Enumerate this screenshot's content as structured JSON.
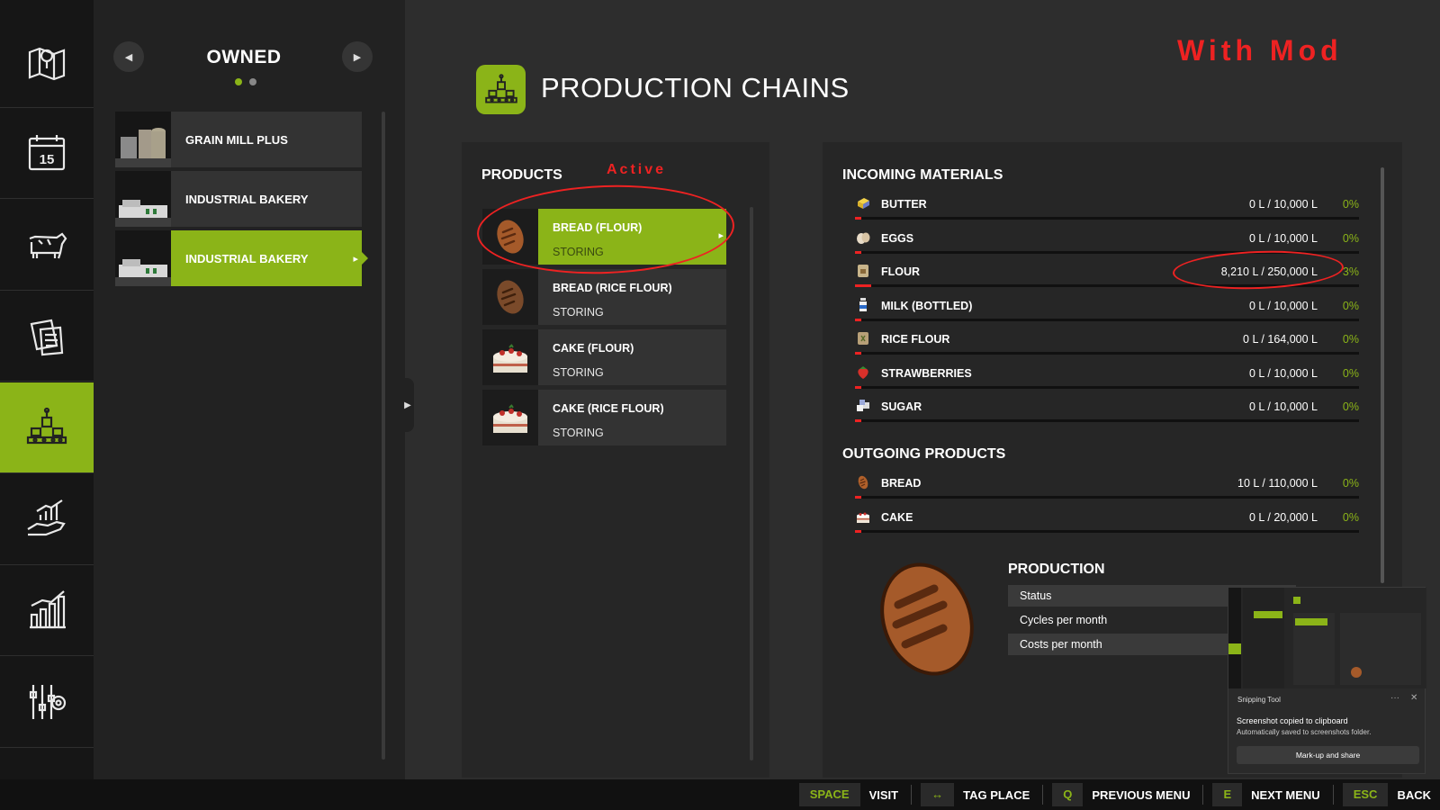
{
  "rail": {
    "items": [
      {
        "name": "map",
        "icon": "map-pin-icon"
      },
      {
        "name": "calendar",
        "icon": "calendar-icon",
        "label": "15"
      },
      {
        "name": "animals",
        "icon": "cow-icon"
      },
      {
        "name": "contracts",
        "icon": "documents-icon"
      },
      {
        "name": "production",
        "icon": "production-factory-icon",
        "active": true
      },
      {
        "name": "finances",
        "icon": "hand-chart-icon"
      },
      {
        "name": "statistics",
        "icon": "bar-chart-icon"
      },
      {
        "name": "settings",
        "icon": "gear-sliders-icon"
      }
    ]
  },
  "owned": {
    "title": "OWNED",
    "items": [
      {
        "label": "GRAIN MILL PLUS"
      },
      {
        "label": "INDUSTRIAL BAKERY"
      },
      {
        "label": "INDUSTRIAL BAKERY",
        "active": true
      }
    ]
  },
  "main": {
    "title": "PRODUCTION CHAINS",
    "annotation": "With Mod"
  },
  "products": {
    "title": "PRODUCTS",
    "annotation": "Active",
    "items": [
      {
        "name": "BREAD (FLOUR)",
        "status": "STORING",
        "icon": "bread-icon",
        "active": true
      },
      {
        "name": "BREAD (RICE FLOUR)",
        "status": "STORING",
        "icon": "bread-icon"
      },
      {
        "name": "CAKE (FLOUR)",
        "status": "STORING",
        "icon": "cake-icon"
      },
      {
        "name": "CAKE (RICE FLOUR)",
        "status": "STORING",
        "icon": "cake-icon"
      }
    ]
  },
  "incoming": {
    "title": "INCOMING MATERIALS",
    "items": [
      {
        "name": "BUTTER",
        "value": "0 L / 10,000 L",
        "percent": "0%",
        "fill": 0.0,
        "icon": "butter-icon"
      },
      {
        "name": "EGGS",
        "value": "0 L / 10,000 L",
        "percent": "0%",
        "fill": 0.0,
        "icon": "eggs-icon"
      },
      {
        "name": "FLOUR",
        "value": "8,210 L / 250,000 L",
        "percent": "3%",
        "fill": 0.033,
        "icon": "flour-icon"
      },
      {
        "name": "MILK (BOTTLED)",
        "value": "0 L / 10,000 L",
        "percent": "0%",
        "fill": 0.0,
        "icon": "milk-bottle-icon"
      },
      {
        "name": "RICE FLOUR",
        "value": "0 L / 164,000 L",
        "percent": "0%",
        "fill": 0.0,
        "icon": "rice-flour-icon"
      },
      {
        "name": "STRAWBERRIES",
        "value": "0 L / 10,000 L",
        "percent": "0%",
        "fill": 0.0,
        "icon": "strawberry-icon"
      },
      {
        "name": "SUGAR",
        "value": "0 L / 10,000 L",
        "percent": "0%",
        "fill": 0.0,
        "icon": "sugar-icon"
      }
    ]
  },
  "outgoing": {
    "title": "OUTGOING PRODUCTS",
    "items": [
      {
        "name": "BREAD",
        "value": "10 L / 110,000 L",
        "percent": "0%",
        "fill": 0.0,
        "icon": "bread-icon"
      },
      {
        "name": "CAKE",
        "value": "0 L / 20,000 L",
        "percent": "0%",
        "fill": 0.0,
        "icon": "cake-icon"
      }
    ]
  },
  "production": {
    "title": "PRODUCTION",
    "rows": [
      "Status",
      "Cycles per month",
      "Costs per month"
    ]
  },
  "snip": {
    "app": "Snipping Tool",
    "more": "···",
    "close": "✕",
    "message": "Screenshot copied to clipboard",
    "sub": "Automatically saved to screenshots folder.",
    "button": "Mark-up and share"
  },
  "bottom": {
    "keys": [
      {
        "key": "SPACE",
        "label": "VISIT"
      },
      {
        "key": "↔",
        "label": "TAG PLACE"
      },
      {
        "key": "Q",
        "label": "PREVIOUS MENU"
      },
      {
        "key": "E",
        "label": "NEXT MENU"
      },
      {
        "key": "ESC",
        "label": "BACK"
      }
    ]
  },
  "colors": {
    "accent": "#8bb418",
    "annotation_red": "#e22222",
    "background": "#2d2d2d",
    "rail": "#161616"
  }
}
